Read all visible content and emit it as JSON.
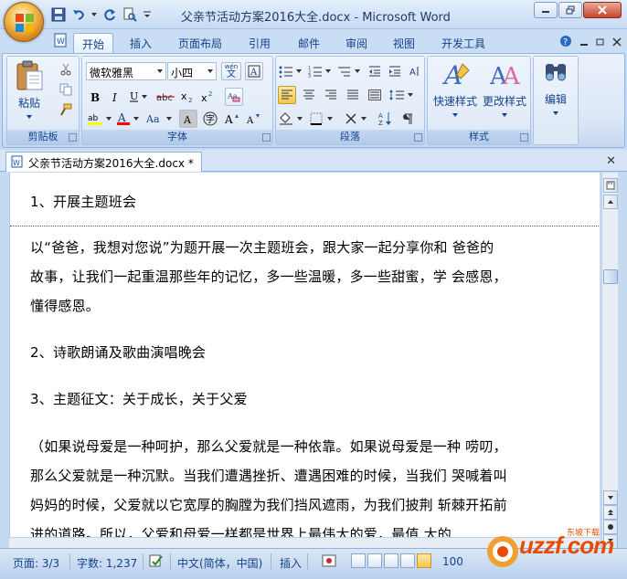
{
  "app": {
    "title": "父亲节活动方案2016大全.docx - Microsoft Word",
    "doc_tab_label": "父亲节活动方案2016大全.docx *"
  },
  "ribbon_tabs": [
    "开始",
    "插入",
    "页面布局",
    "引用",
    "邮件",
    "审阅",
    "视图",
    "开发工具"
  ],
  "ribbon": {
    "clipboard": {
      "paste_label": "粘贴",
      "group_label": "剪贴板"
    },
    "font": {
      "font_name": "微软雅黑",
      "font_size": "小四",
      "wen_label": "wén",
      "wen_char": "文",
      "group_label": "字体"
    },
    "paragraph": {
      "group_label": "段落"
    },
    "styles": {
      "quick_styles_label": "快速样式",
      "change_styles_label": "更改样式",
      "group_label": "样式"
    },
    "editing": {
      "label": "编辑"
    }
  },
  "document": {
    "paragraphs": [
      "1、开展主题班会",
      "以“爸爸，我想对您说”为题开展一次主题班会，跟大家一起分享你和 爸爸的",
      "故事，让我们一起重温那些年的记忆，多一些温暖，多一些甜蜜，学 会感恩，",
      "懂得感恩。",
      "2、诗歌朗诵及歌曲演唱晚会",
      "3、主题征文：关于成长，关于父爱",
      "（如果说母爱是一种呵护，那么父爱就是一种依靠。如果说母爱是一种 唠叨，",
      "那么父爱就是一种沉默。当我们遭遇挫折、遭遇困难的时候，当我们 哭喊着叫",
      "妈妈的时候，父爱就以它宽厚的胸膛为我们挡风遮雨，为我们披荆 斩棘开拓前",
      "进的道路。所以，父爱和母爱一样都是世界上最伟大的爱，最值 大的"
    ]
  },
  "statusbar": {
    "page": "页面: 3/3",
    "words": "字数: 1,237",
    "language": "中文(简体，中国)",
    "mode": "插入",
    "zoom": "100"
  },
  "watermark": {
    "text": "uzzf.com",
    "sub": "东坡下载"
  },
  "colors": {
    "accent": "#15428b",
    "highlight": "#ffff00",
    "font_color": "#ff0000"
  }
}
